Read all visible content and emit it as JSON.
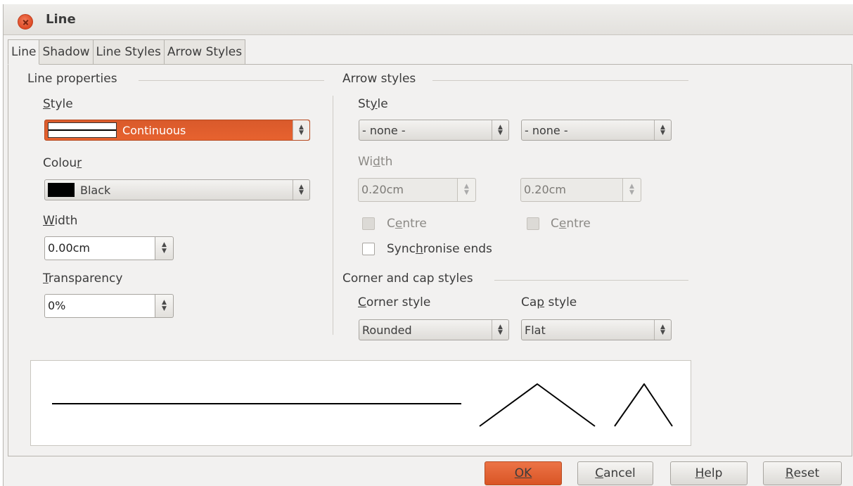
{
  "window": {
    "title": "Line"
  },
  "tabs": [
    "Line",
    "Shadow",
    "Line Styles",
    "Arrow Styles"
  ],
  "line_properties": {
    "heading": "Line properties",
    "style_label": "Style",
    "style_value": "Continuous",
    "colour_label": "Colour",
    "colour_value": "Black",
    "colour_swatch": "#000000",
    "width_label": "Width",
    "width_value": "0.00cm",
    "transparency_label": "Transparency",
    "transparency_value": "0%"
  },
  "arrow_styles": {
    "heading": "Arrow styles",
    "style_label": "Style",
    "start_style": "- none -",
    "end_style": "- none -",
    "width_label": "Width",
    "start_width": "0.20cm",
    "end_width": "0.20cm",
    "centre_label": "Centre",
    "sync_label": "Synchronise ends"
  },
  "corner_cap": {
    "heading": "Corner and cap styles",
    "corner_label": "Corner style",
    "corner_value": "Rounded",
    "cap_label": "Cap style",
    "cap_value": "Flat"
  },
  "buttons": {
    "ok": "OK",
    "cancel": "Cancel",
    "help": "Help",
    "reset": "Reset"
  },
  "colors": {
    "accent": "#e0582a",
    "background": "#f2f1f0"
  }
}
